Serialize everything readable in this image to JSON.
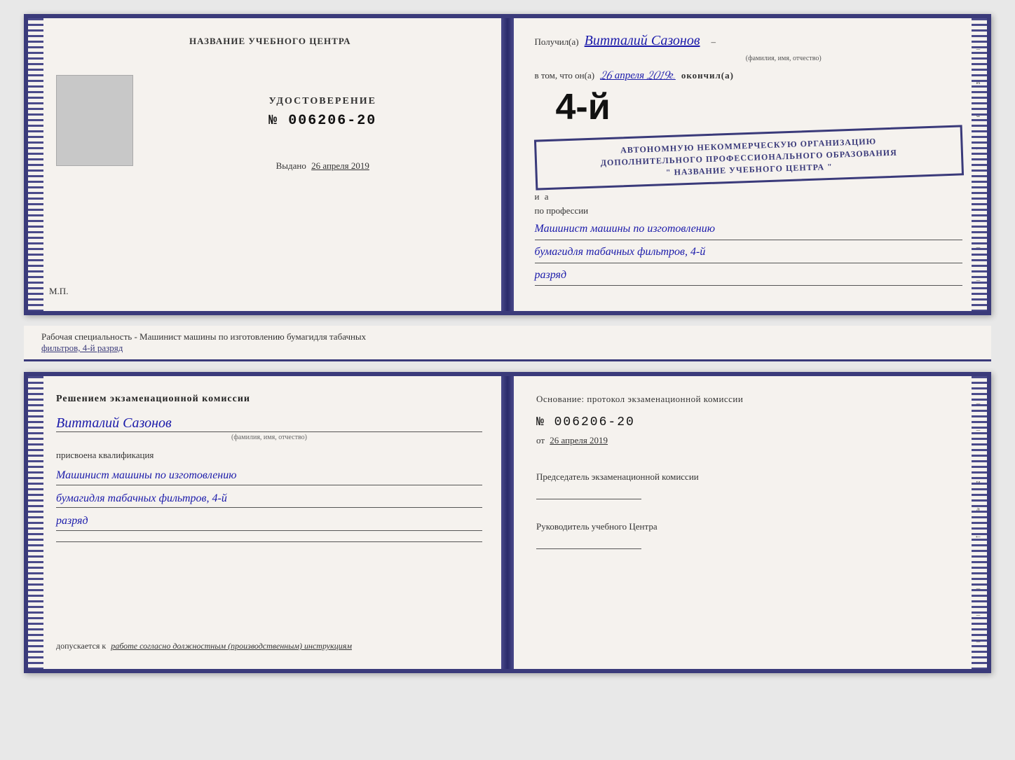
{
  "document": {
    "top": {
      "left_page": {
        "header": "НАЗВАНИЕ УЧЕБНОГО ЦЕНТРА",
        "cert_title": "УДОСТОВЕРЕНИЕ",
        "cert_number": "№ 006206-20",
        "issued_label": "Выдано",
        "issued_date": "26 апреля 2019",
        "mp_label": "М.П."
      },
      "right_page": {
        "received_label": "Получил(а)",
        "recipient_name": "Витталий Сазонов",
        "fio_caption": "(фамилия, имя, отчество)",
        "in_that_label": "в том, что он(а)",
        "completed_date": "26 апреля 2019г.",
        "completed_label": "окончил(а)",
        "rank_big": "4-й",
        "org_line1": "АВТОНОМНУЮ НЕКОММЕРЧЕСКУЮ ОРГАНИЗАЦИЮ",
        "org_line2": "ДОПОЛНИТЕЛЬНОГО ПРОФЕССИОНАЛЬНОГО ОБРАЗОВАНИЯ",
        "org_name": "\" НАЗВАНИЕ УЧЕБНОГО ЦЕНТРА \"",
        "conjunction": "и",
        "profession_label": "по профессии",
        "profession_line1": "Машинист машины по изготовлению",
        "profession_line2": "бумагидля табачных фильтров, 4-й",
        "profession_line3": "разряд"
      }
    },
    "info_bar": {
      "label": "Рабочая специальность - Машинист машины по изготовлению бумагидля табачных",
      "underline_text": "фильтров, 4-й разряд"
    },
    "bottom": {
      "left_page": {
        "title": "Решением  экзаменационной  комиссии",
        "name": "Витталий Сазонов",
        "fio_caption": "(фамилия, имя, отчество)",
        "assigned_label": "присвоена квалификация",
        "qual_line1": "Машинист машины по изготовлению",
        "qual_line2": "бумагидля табачных фильтров, 4-й",
        "qual_line3": "разряд",
        "допускается_prefix": "допускается к",
        "допускается_text": "работе согласно должностным (производственным) инструкциям"
      },
      "right_page": {
        "basis_label": "Основание: протокол экзаменационной  комиссии",
        "protocol_number": "№  006206-20",
        "date_prefix": "от",
        "date_value": "26 апреля 2019",
        "chairman_label": "Председатель экзаменационной комиссии",
        "director_label": "Руководитель учебного Центра"
      }
    }
  },
  "colors": {
    "border": "#3a3a7a",
    "handwriting": "#1a1aaa",
    "text": "#222222",
    "background": "#f5f2ee"
  }
}
